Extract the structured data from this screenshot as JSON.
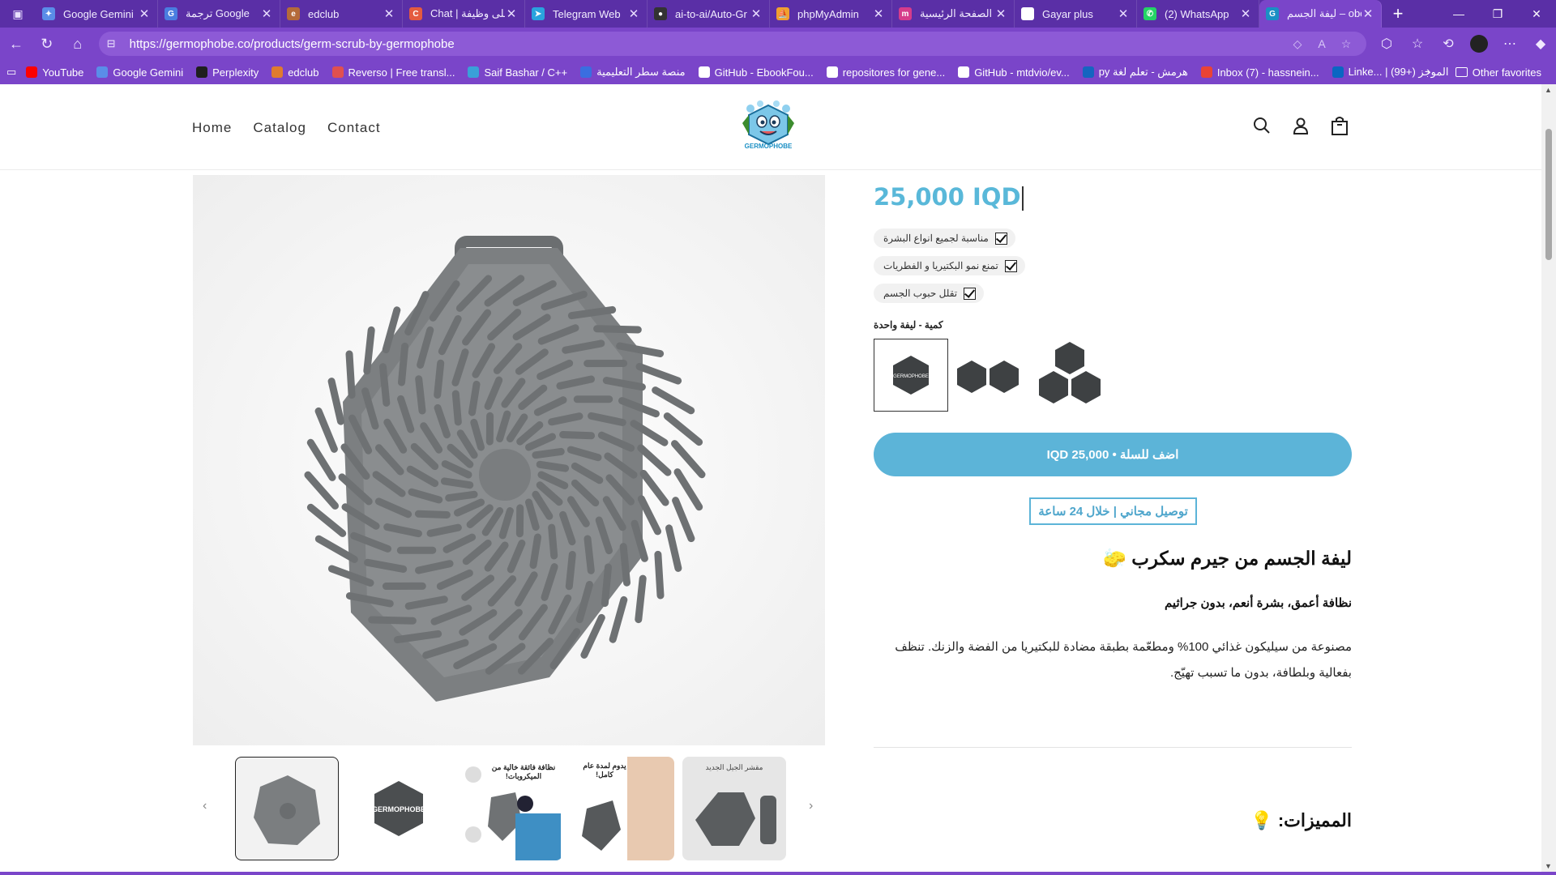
{
  "browser": {
    "tabs": [
      {
        "title": "Google Gemini",
        "color": "#5a8de8",
        "glyph": "✦"
      },
      {
        "title": "ترجمة Google",
        "color": "#4a7de0",
        "glyph": "G"
      },
      {
        "title": "edclub",
        "color": "#b46a3a",
        "glyph": "e"
      },
      {
        "title": "Chat | على وظيفة",
        "color": "#e45b3f",
        "glyph": "C"
      },
      {
        "title": "Telegram Web",
        "color": "#2aa3de",
        "glyph": "➤"
      },
      {
        "title": "ai-to-ai/Auto-Gr",
        "color": "#333333",
        "glyph": "●"
      },
      {
        "title": "phpMyAdmin",
        "color": "#f0a030",
        "glyph": "⛵"
      },
      {
        "title": "الصفحة الرئيسية",
        "color": "#d63c8b",
        "glyph": "m"
      },
      {
        "title": "Gayar plus",
        "color": "#ffffff",
        "glyph": ""
      },
      {
        "title": "(2) WhatsApp",
        "color": "#25d366",
        "glyph": "✆"
      },
      {
        "title": "ليفة الجسم – obe",
        "color": "#1a8fc4",
        "glyph": "G"
      }
    ],
    "url": "https://germophobe.co/products/germ-scrub-by-germophobe",
    "bookmarks": [
      {
        "label": "YouTube",
        "color": "#ff0000"
      },
      {
        "label": "Google Gemini",
        "color": "#5a8de8"
      },
      {
        "label": "Perplexity",
        "color": "#1f1f1f"
      },
      {
        "label": "edclub",
        "color": "#e07b2e"
      },
      {
        "label": "Reverso | Free transl...",
        "color": "#e05050"
      },
      {
        "label": "Saif Bashar / C++",
        "color": "#3aa0d8"
      },
      {
        "label": "منصة سطر التعليمية",
        "color": "#3a6ee0"
      },
      {
        "label": "GitHub - EbookFou...",
        "color": "#ffffff"
      },
      {
        "label": "repositores for gene...",
        "color": "#ffffff"
      },
      {
        "label": "GitHub - mtdvio/ev...",
        "color": "#ffffff"
      },
      {
        "label": "py هرمش - تعلم لغة",
        "color": "#1565c0"
      },
      {
        "label": "Inbox (7) - hassnein...",
        "color": "#ea4335"
      },
      {
        "label": "Linke... | الموجز (+99)",
        "color": "#0a66c2"
      }
    ],
    "other_favorites": "Other favorites"
  },
  "store": {
    "nav": [
      "Home",
      "Catalog",
      "Contact"
    ],
    "logo_text": "GERMOPHOBE",
    "brand_color": "#5cb4d8"
  },
  "product": {
    "price": "25,000 IQD",
    "features": [
      "مناسبة لجميع انواع البشرة",
      "تمنع نمو البكتيريا و الفطريات",
      "تقلل حبوب الجسم"
    ],
    "quantity_label": "كمية - ليفة واحدة",
    "variant_count_selected": 1,
    "cart_button": "اضف للسلة • 25,000 IQD",
    "shipping_badge": "توصيل مجاني | خلال 24 ساعة",
    "title": "ليفة الجسم من جيرم سكرب 🧽",
    "subtitle": "نظافة أعمق، بشرة أنعم، بدون جراثيم",
    "description": "مصنوعة من سيليكون غذائي 100% ومطعّمة بطبقة مضادة للبكتيريا من الفضة والزنك. تنظف بفعالية وبلطافة، بدون ما تسبب تهيّج.",
    "features_heading": "المميزات: 💡",
    "thumb_texts": {
      "t3": "نظافة فائقة خالية من الميكروبات!",
      "t4": "يدوم لمدة عام كامل!",
      "t5": "مقشر الجيل الجديد"
    }
  }
}
